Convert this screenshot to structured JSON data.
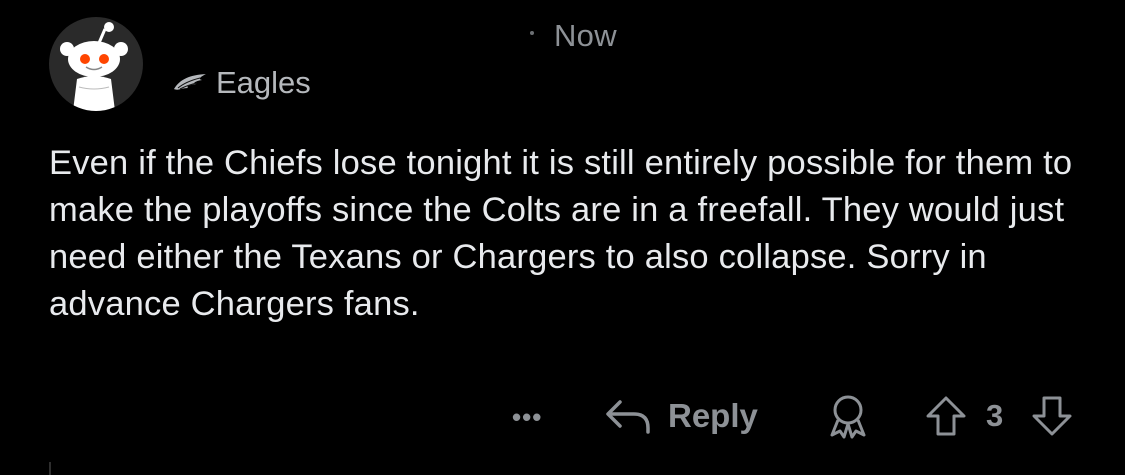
{
  "comment": {
    "timestamp": "Now",
    "flair": {
      "icon": "eagle-wing-icon",
      "text": "Eagles"
    },
    "body": "Even if the Chiefs lose tonight it is still entirely possible for them to make the playoffs since the Colts are in a freefall. They would just need either the Texans or Chargers to also collapse. Sorry in advance Chargers fans.",
    "actions": {
      "more_label": "•••",
      "reply_label": "Reply",
      "score": "3"
    }
  },
  "colors": {
    "background": "#000000",
    "text": "#e8eaed",
    "muted": "#8d9196",
    "avatar_bg": "#2a2a2a",
    "snoo_eye": "#ff4500"
  }
}
